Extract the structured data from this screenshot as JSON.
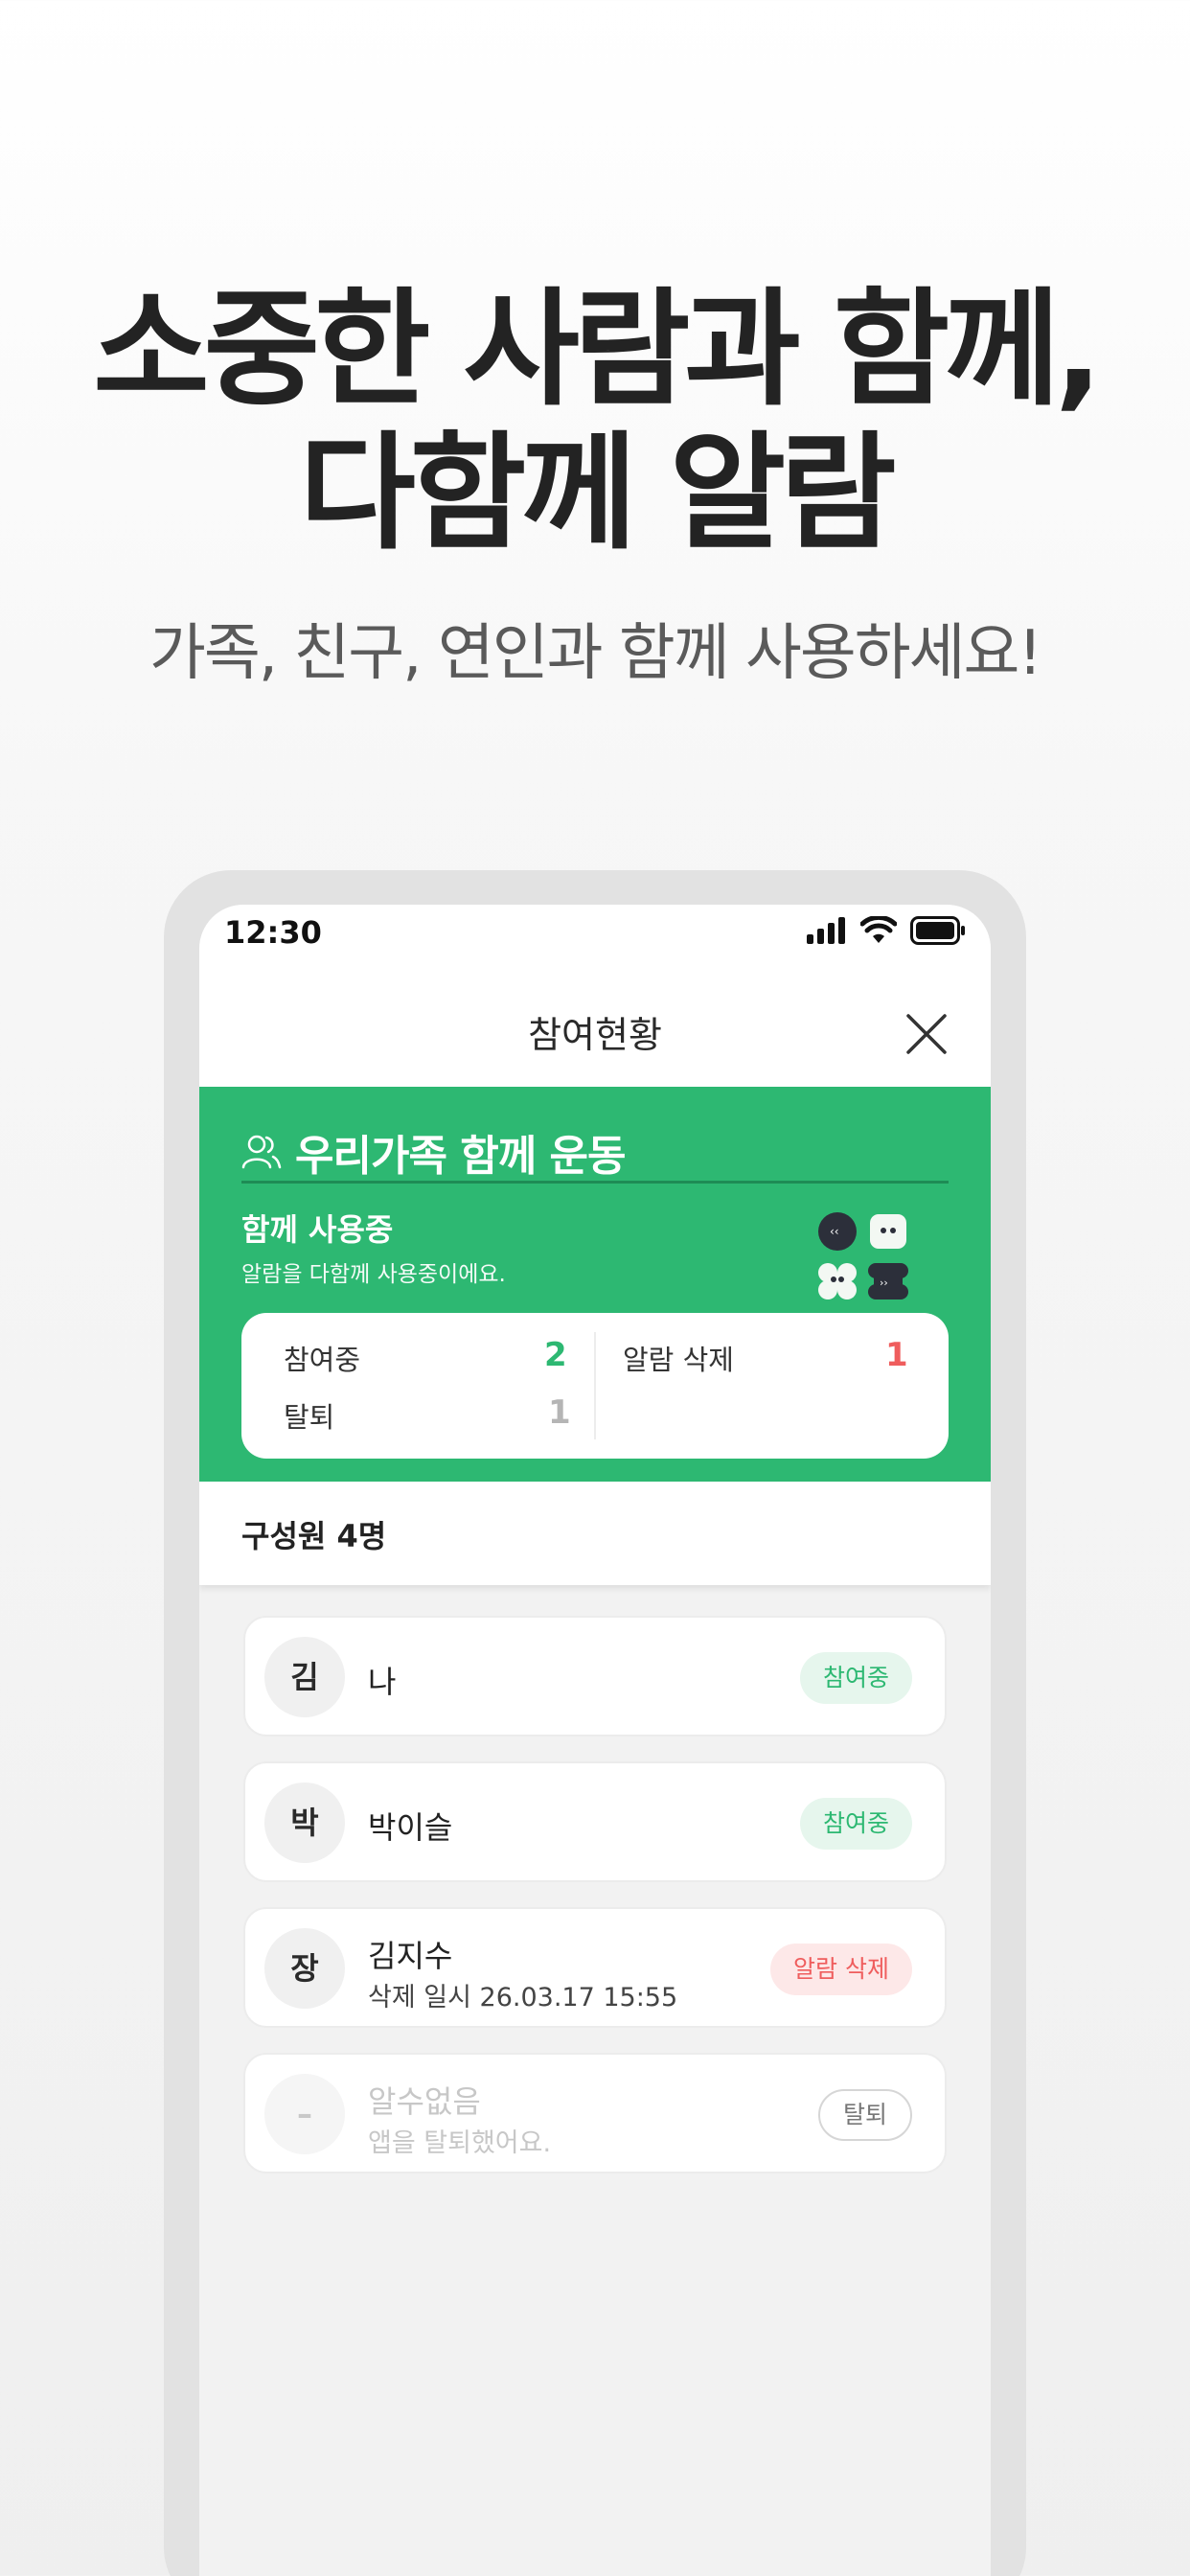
{
  "promo": {
    "headline_line1": "소중한 사람과 함께,",
    "headline_line2": "다함께 알람",
    "subline": "가족, 친구, 연인과 함께 사용하세요!"
  },
  "statusbar": {
    "time": "12:30",
    "icons": [
      "signal-icon",
      "wifi-icon",
      "battery-icon"
    ]
  },
  "navbar": {
    "title": "참여현황",
    "close_icon": "close-icon"
  },
  "group": {
    "icon": "people-icon",
    "name": "우리가족 함께 운동",
    "status_title": "함께 사용중",
    "status_desc": "알람을 다함께 사용중이에요.",
    "stats": {
      "joined_label": "참여중",
      "joined_value": "2",
      "left_label": "탈퇴",
      "left_value": "1",
      "deleted_label": "알람 삭제",
      "deleted_value": "1"
    }
  },
  "members_header": "구성원 4명",
  "members": [
    {
      "avatar": "김",
      "name": "나",
      "sub": "",
      "badge": "참여중",
      "state": "joined"
    },
    {
      "avatar": "박",
      "name": "박이슬",
      "sub": "",
      "badge": "참여중",
      "state": "joined"
    },
    {
      "avatar": "장",
      "name": "김지수",
      "sub": "삭제 일시 26.03.17 15:55",
      "badge": "알람 삭제",
      "state": "deleted"
    },
    {
      "avatar": "–",
      "name": "알수없음",
      "sub": "앱을 탈퇴했어요.",
      "badge": "탈퇴",
      "state": "left"
    }
  ],
  "colors": {
    "brand_green": "#2db872",
    "delete_red": "#ef5d5d",
    "muted_gray": "#b5b5b5"
  }
}
